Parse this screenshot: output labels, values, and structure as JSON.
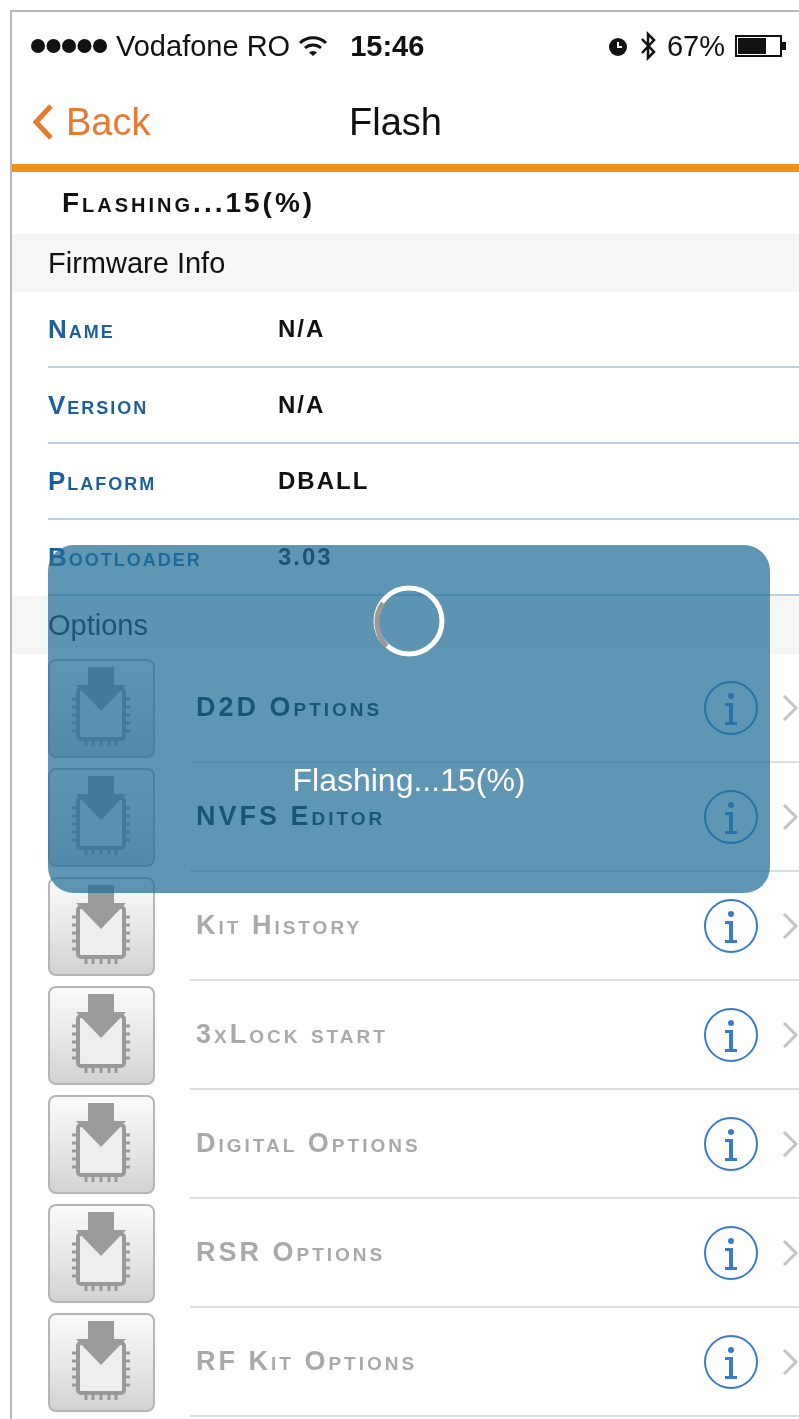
{
  "status_bar": {
    "carrier": "Vodafone RO",
    "time": "15:46",
    "battery": "67%"
  },
  "nav": {
    "back": "Back",
    "title": "Flash"
  },
  "status_text": "Flashing...15(%)",
  "firmware_info": {
    "header": "Firmware Info",
    "rows": [
      {
        "label": "Name",
        "value": "N/A"
      },
      {
        "label": "Version",
        "value": "N/A"
      },
      {
        "label": "Plaform",
        "value": "DBALL"
      },
      {
        "label": "Bootloader",
        "value": "3.03"
      }
    ]
  },
  "options": {
    "header": "Options",
    "items": [
      {
        "label": "D2D Options",
        "disabled": false
      },
      {
        "label": "NVFS Editor",
        "disabled": false
      },
      {
        "label": "Kit History",
        "disabled": true
      },
      {
        "label": "3xLock start",
        "disabled": true
      },
      {
        "label": "Digital Options",
        "disabled": true
      },
      {
        "label": "RSR Options",
        "disabled": true
      },
      {
        "label": "RF Kit Options",
        "disabled": true
      }
    ]
  },
  "progress_overlay": {
    "message": "Flashing...15(%)"
  }
}
